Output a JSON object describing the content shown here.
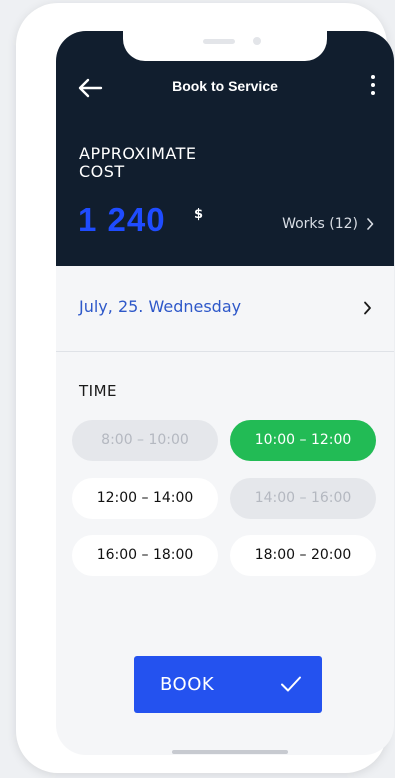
{
  "header": {
    "title": "Book to Service",
    "cost_label": "APPROXIMATE COST",
    "cost_value": "1 240",
    "currency": "$",
    "works_label": "Works (12)"
  },
  "date": {
    "text": "July, 25. Wednesday"
  },
  "time": {
    "label": "TIME",
    "slots": [
      {
        "label": "8:00 – 10:00",
        "state": "disabled"
      },
      {
        "label": "10:00 – 12:00",
        "state": "selected"
      },
      {
        "label": "12:00 – 14:00",
        "state": "available"
      },
      {
        "label": "14:00 – 16:00",
        "state": "disabled"
      },
      {
        "label": "16:00 – 18:00",
        "state": "available"
      },
      {
        "label": "18:00 – 20:00",
        "state": "available"
      }
    ]
  },
  "actions": {
    "book_label": "BOOK"
  },
  "colors": {
    "header_bg": "#111e2e",
    "accent_blue": "#2452ef",
    "selected_green": "#22bb55",
    "date_link": "#2e58c9"
  },
  "icons": {
    "back": "arrow-left-icon",
    "more": "more-vertical-icon",
    "works_chevron": "chevron-right-icon",
    "date_chevron": "chevron-right-icon",
    "confirm": "check-icon"
  }
}
